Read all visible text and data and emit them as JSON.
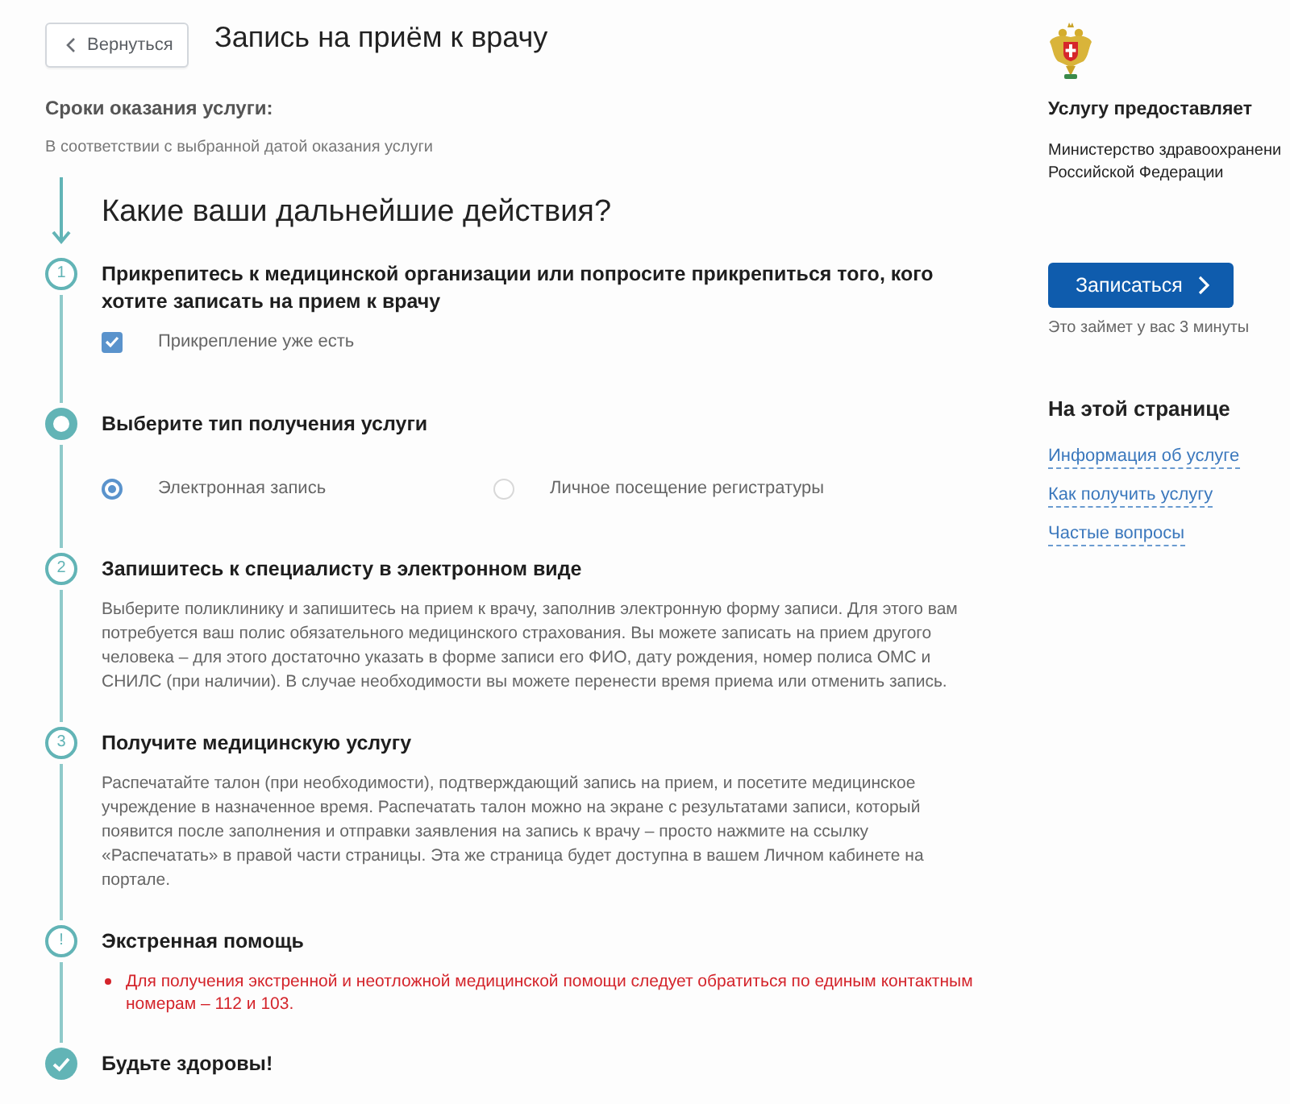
{
  "back_button": {
    "label": "Вернуться"
  },
  "title": "Запись на приём к врачу",
  "service_terms": {
    "heading": "Сроки оказания услуги:",
    "text": "В соответствии с выбранной датой оказания услуги"
  },
  "steps_heading": "Какие ваши дальнейшие действия?",
  "steps": [
    {
      "kind": "number",
      "marker": "1",
      "heading": "Прикрепитесь к медицинской организации или попросите прикрепиться того, кого хотите записать на прием к врачу",
      "checkbox": {
        "label": "Прикрепление уже есть",
        "checked": true
      }
    },
    {
      "kind": "current",
      "heading": "Выберите тип получения услуги",
      "options": [
        {
          "label": "Электронная запись",
          "selected": true
        },
        {
          "label": "Личное посещение регистратуры",
          "selected": false
        }
      ]
    },
    {
      "kind": "number",
      "marker": "2",
      "heading": "Запишитесь к специалисту в электронном виде",
      "text": "Выберите поликлинику и запишитесь на прием к врачу, заполнив электронную форму записи. Для этого вам потребуется ваш полис обязательного медицинского страхования. Вы можете записать на прием другого человека – для этого достаточно указать в форме записи его ФИО, дату рождения, номер полиса ОМС и СНИЛС (при наличии). В случае необходимости вы можете перенести время приема или отменить запись."
    },
    {
      "kind": "number",
      "marker": "3",
      "heading": "Получите медицинскую услугу",
      "text": "Распечатайте талон (при необходимости), подтверждающий запись на прием, и посетите медицинское учреждение в назначенное время. Распечатать талон можно на экране с результатами записи, который появится после заполнения и отправки заявления на запись к врачу – просто нажмите на ссылку «Распечатать» в правой части страницы. Эта же страница будет доступна в вашем Личном кабинете на портале."
    },
    {
      "kind": "alert",
      "marker": "!",
      "heading": "Экстренная помощь",
      "bullets": [
        "Для получения экстренной и неотложной медицинской помощи следует обратиться по единым контактным номерам – 112 и 103."
      ]
    },
    {
      "kind": "done",
      "heading": "Будьте здоровы!"
    }
  ],
  "sidebar": {
    "provider_heading": "Услугу предоставляет",
    "provider_lines": [
      "Министерство здравоохранени",
      "Российской Федерации"
    ],
    "sign_up_button": {
      "label": "Записаться"
    },
    "note": "Это займет у вас 3 минуты",
    "toc_heading": "На этой странице",
    "toc_links": [
      "Информация об услуге",
      "Как получить услугу",
      "Частые вопросы"
    ]
  }
}
